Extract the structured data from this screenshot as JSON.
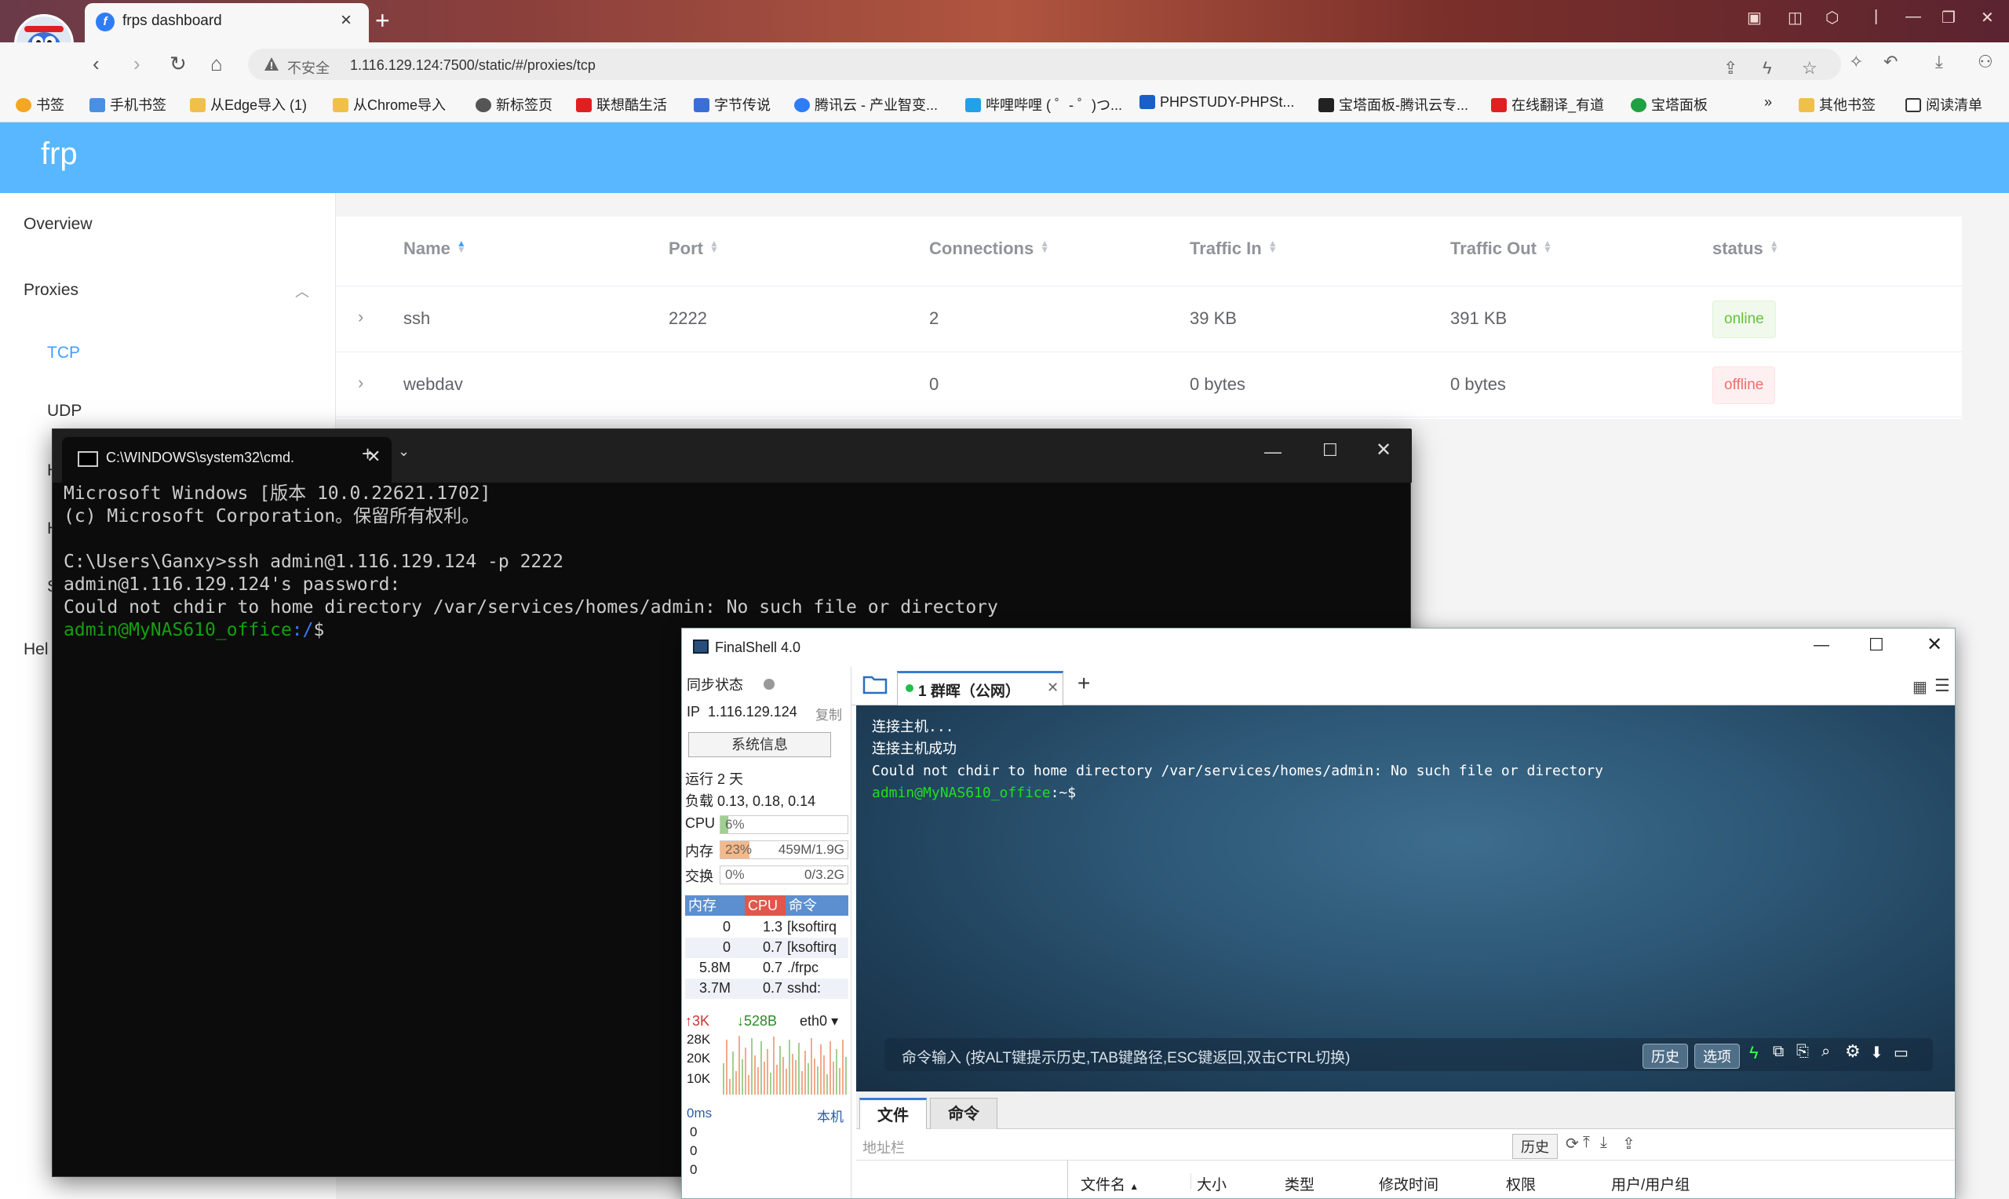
{
  "browser": {
    "tab_title": "frps dashboard",
    "tab_close": "×",
    "new_tab": "+",
    "insecure_label": "不安全",
    "url": "1.116.129.124:7500/static/#/proxies/tcp",
    "bookmarks": [
      {
        "label": "书签",
        "color": "#f5a623"
      },
      {
        "label": "手机书签",
        "color": "#4a90e2"
      },
      {
        "label": "从Edge导入 (1)",
        "color": "#f0c04a"
      },
      {
        "label": "从Chrome导入",
        "color": "#f0c04a"
      },
      {
        "label": "新标签页",
        "color": "#555555"
      },
      {
        "label": "联想酷生活",
        "color": "#e02020"
      },
      {
        "label": "字节传说",
        "color": "#3a6fd8"
      },
      {
        "label": "腾讯云 - 产业智变...",
        "color": "#2f7df6"
      },
      {
        "label": "哔哩哔哩 ( ゜- ゜)つ...",
        "color": "#23a0e8"
      },
      {
        "label": "PHPSTUDY-PHPSt...",
        "color": "#1a5fc8"
      },
      {
        "label": "宝塔面板-腾讯云专...",
        "color": "#222222"
      },
      {
        "label": "在线翻译_有道",
        "color": "#e02020"
      },
      {
        "label": "宝塔面板",
        "color": "#20a040"
      }
    ],
    "bookmarks_more": "»",
    "other_bookmarks": "其他书签",
    "reading_list": "阅读清单"
  },
  "frp": {
    "logo": "frp",
    "sidebar": {
      "overview": "Overview",
      "proxies": "Proxies",
      "tcp": "TCP",
      "udp": "UDP",
      "hidden_1": "H",
      "hidden_2": "H",
      "hidden_3": "S",
      "help": "Hel"
    },
    "table": {
      "headers": [
        "Name",
        "Port",
        "Connections",
        "Traffic In",
        "Traffic Out",
        "status"
      ],
      "rows": [
        {
          "name": "ssh",
          "port": "2222",
          "connections": "2",
          "traffic_in": "39 KB",
          "traffic_out": "391 KB",
          "status": "online"
        },
        {
          "name": "webdav",
          "port": "",
          "connections": "0",
          "traffic_in": "0 bytes",
          "traffic_out": "0 bytes",
          "status": "offline"
        }
      ]
    },
    "colors": {
      "header": "#58b7ff",
      "online": "#67c23a",
      "offline": "#f56c6c",
      "active": "#409eff"
    }
  },
  "cmd": {
    "tab_title": "C:\\WINDOWS\\system32\\cmd.",
    "lines": [
      "Microsoft Windows [版本 10.0.22621.1702]",
      "(c) Microsoft Corporation。保留所有权利。",
      "",
      "C:\\Users\\Ganxy>ssh admin@1.116.129.124 -p 2222",
      "admin@1.116.129.124's password:",
      "Could not chdir to home directory /var/services/homes/admin: No such file or directory"
    ],
    "prompt_user": "admin@MyNAS610_office",
    "prompt_path": ":/",
    "prompt_symbol": "$"
  },
  "finalshell": {
    "title": "FinalShell 4.0",
    "sync_status": "同步状态",
    "ip_label": "IP",
    "ip": "1.116.129.124",
    "copy": "复制",
    "sysinfo_button": "系统信息",
    "uptime": "运行 2 天",
    "load": "负载 0.13, 0.18, 0.14",
    "cpu_label": "CPU",
    "cpu_value": "6%",
    "cpu_fraction": 0.06,
    "mem_label": "内存",
    "mem_value": "23%",
    "mem_detail": "459M/1.9G",
    "mem_fraction": 0.23,
    "swap_label": "交换",
    "swap_value": "0%",
    "swap_detail": "0/3.2G",
    "swap_fraction": 0,
    "proc_headers": [
      "内存",
      "CPU",
      "命令"
    ],
    "processes": [
      {
        "mem": "0",
        "cpu": "1.3",
        "cmd": "[ksoftirq"
      },
      {
        "mem": "0",
        "cpu": "0.7",
        "cmd": "[ksoftirq"
      },
      {
        "mem": "5.8M",
        "cpu": "0.7",
        "cmd": "./frpc"
      },
      {
        "mem": "3.7M",
        "cpu": "0.7",
        "cmd": "sshd:"
      }
    ],
    "net_up": "3K",
    "net_down": "528B",
    "net_iface": "eth0",
    "net_scale": [
      "28K",
      "20K",
      "10K"
    ],
    "latency_label": "0ms",
    "latency_host": "本机",
    "latency_values": [
      "0",
      "0",
      "0"
    ],
    "session_tab": "1 群晖（公网）",
    "terminal_lines": [
      "连接主机...",
      "连接主机成功",
      "Could not chdir to home directory /var/services/homes/admin: No such file or directory"
    ],
    "terminal_prompt_user": "admin@MyNAS610_office",
    "terminal_prompt_rest": ":~$",
    "cmd_input_placeholder": "命令输入 (按ALT键提示历史,TAB键路径,ESC键返回,双击CTRL切换)",
    "history_button": "历史",
    "options_button": "选项",
    "files_tab": "文件",
    "commands_tab": "命令",
    "address_placeholder": "地址栏",
    "files_history_button": "历史",
    "file_columns": [
      "文件名",
      "大小",
      "类型",
      "修改时间",
      "权限",
      "用户/用户组"
    ]
  }
}
